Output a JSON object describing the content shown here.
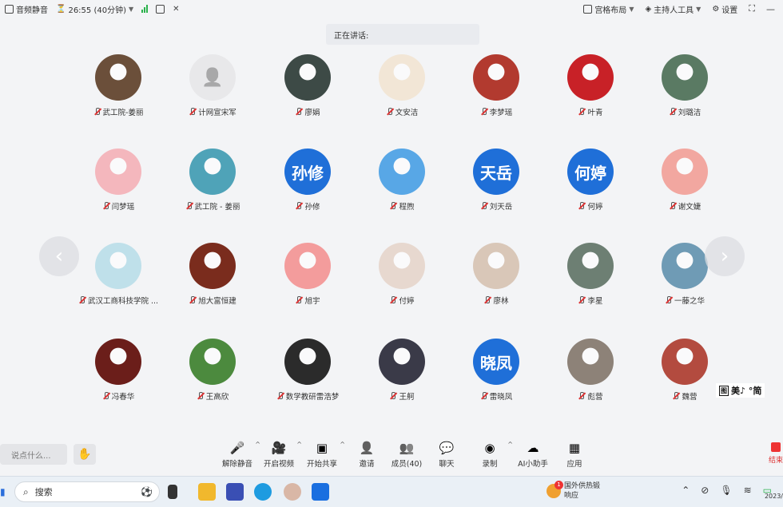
{
  "topbar": {
    "app_label": "音频静音",
    "timer": "26:55 (40分钟)",
    "layout_label": "宫格布局",
    "host_tools_label": "主持人工具",
    "settings_label": "设置"
  },
  "speaking": {
    "label": "正在讲话:"
  },
  "participants": [
    {
      "name": "武工院-姜丽",
      "avatar": "photo"
    },
    {
      "name": "计网宣宋军",
      "avatar": "blank"
    },
    {
      "name": "廖娟",
      "avatar": "photo"
    },
    {
      "name": "文安洁",
      "avatar": "photo"
    },
    {
      "name": "李梦瑶",
      "avatar": "photo"
    },
    {
      "name": "叶青",
      "avatar": "photo"
    },
    {
      "name": "刘璐洁",
      "avatar": "photo"
    },
    {
      "name": "闫梦瑶",
      "avatar": "photo"
    },
    {
      "name": "武工院 - 姜丽",
      "avatar": "photo"
    },
    {
      "name": "孙修",
      "avatar": "text",
      "avatar_text": "孙修"
    },
    {
      "name": "程煦",
      "avatar": "photo"
    },
    {
      "name": "刘天岳",
      "avatar": "text",
      "avatar_text": "天岳"
    },
    {
      "name": "何婷",
      "avatar": "text",
      "avatar_text": "何婷"
    },
    {
      "name": "谢文婕",
      "avatar": "photo"
    },
    {
      "name": "武汉工商科技学院 ...",
      "avatar": "photo"
    },
    {
      "name": "旭大富恒建",
      "avatar": "photo"
    },
    {
      "name": "旭宇",
      "avatar": "photo"
    },
    {
      "name": "付婷",
      "avatar": "photo"
    },
    {
      "name": "廖林",
      "avatar": "photo"
    },
    {
      "name": "李星",
      "avatar": "photo"
    },
    {
      "name": "一藤之华",
      "avatar": "photo"
    },
    {
      "name": "冯春华",
      "avatar": "photo"
    },
    {
      "name": "王高欣",
      "avatar": "photo"
    },
    {
      "name": "数学教研雷浩梦",
      "avatar": "photo"
    },
    {
      "name": "王舸",
      "avatar": "photo"
    },
    {
      "name": "雷晓凤",
      "avatar": "text",
      "avatar_text": "晓凤"
    },
    {
      "name": "彪营",
      "avatar": "photo"
    },
    {
      "name": "魏营",
      "avatar": "photo"
    }
  ],
  "avatar_colors": [
    "#6b4f3a",
    "#e8e8ea",
    "#3d4a46",
    "#f2e6d6",
    "#b23a2f",
    "#c82127",
    "#5a7a63",
    "#f4b7bd",
    "#4fa3b8",
    "#1f6fd8",
    "#58a7e6",
    "#1f6fd8",
    "#1f6fd8",
    "#f2a7a0",
    "#bfe0ea",
    "#7a2c1d",
    "#f39c9c",
    "#e7d8cf",
    "#d9c7b8",
    "#6d7f73",
    "#6f9bb5",
    "#6b1e1a",
    "#4c8a3e",
    "#2b2b2b",
    "#3a3a48",
    "#1f6fd8",
    "#8d8278",
    "#b34b3f"
  ],
  "watermark": {
    "box": "图",
    "text": "美♪ °简"
  },
  "toolbar": {
    "chat_placeholder": "说点什么...",
    "buttons": [
      {
        "label": "解除静音",
        "glyph": "mic-off"
      },
      {
        "label": "开启视频",
        "glyph": "video-off"
      },
      {
        "label": "开始共享",
        "glyph": "share"
      },
      {
        "label": "邀请",
        "glyph": "invite"
      },
      {
        "label": "成员(40)",
        "glyph": "members"
      },
      {
        "label": "聊天",
        "glyph": "chat"
      },
      {
        "label": "录制",
        "glyph": "record"
      },
      {
        "label": "AI小助手",
        "glyph": "ai"
      },
      {
        "label": "应用",
        "glyph": "apps"
      }
    ],
    "end_label": "结束"
  },
  "taskbar": {
    "search_placeholder": "搜索",
    "notification_line1": "国外供热锻",
    "notification_line2": "响应",
    "notification_count": "1",
    "clock": "2023/"
  }
}
